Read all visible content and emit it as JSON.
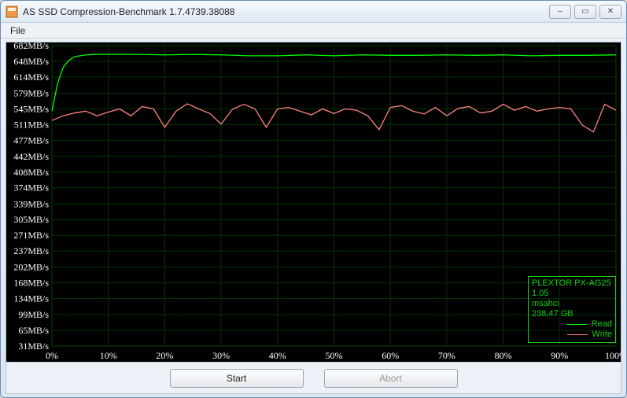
{
  "window": {
    "title": "AS SSD Compression-Benchmark 1.7.4739.38088",
    "minimize": "–",
    "maximize": "▭",
    "close": "✕"
  },
  "menu": {
    "file": "File"
  },
  "info": {
    "drive": "PLEXTOR PX-AG25",
    "fw": "1.05",
    "driver": "msahci",
    "size": "238,47 GB",
    "legend_read": "Read",
    "legend_write": "Write"
  },
  "buttons": {
    "start": "Start",
    "abort": "Abort"
  },
  "chart_data": {
    "type": "line",
    "title": "",
    "xlabel": "",
    "ylabel": "",
    "xlim": [
      0,
      100
    ],
    "ylim": [
      31,
      682
    ],
    "yticks": [
      682,
      648,
      614,
      579,
      545,
      511,
      477,
      442,
      408,
      374,
      339,
      305,
      271,
      237,
      202,
      168,
      134,
      99,
      65,
      31
    ],
    "ytick_suffix": "MB/s",
    "xticks": [
      0,
      10,
      20,
      30,
      40,
      50,
      60,
      70,
      80,
      90,
      100
    ],
    "xtick_suffix": "%",
    "series": [
      {
        "name": "Read",
        "color": "#00ff00",
        "x": [
          0,
          1,
          2,
          3,
          4,
          5,
          6,
          8,
          10,
          12,
          15,
          20,
          25,
          30,
          35,
          40,
          45,
          50,
          55,
          60,
          65,
          70,
          75,
          80,
          85,
          90,
          95,
          100
        ],
        "y": [
          540,
          600,
          635,
          650,
          658,
          660,
          662,
          663,
          663,
          663,
          663,
          662,
          663,
          662,
          660,
          660,
          662,
          660,
          662,
          661,
          661,
          662,
          661,
          662,
          660,
          661,
          661,
          662
        ]
      },
      {
        "name": "Write",
        "color": "#ff8080",
        "x": [
          0,
          2,
          4,
          6,
          8,
          10,
          12,
          14,
          16,
          18,
          20,
          22,
          24,
          26,
          28,
          30,
          32,
          34,
          36,
          38,
          40,
          42,
          44,
          46,
          48,
          50,
          52,
          54,
          56,
          58,
          60,
          62,
          64,
          66,
          68,
          70,
          72,
          74,
          76,
          78,
          80,
          82,
          84,
          86,
          88,
          90,
          92,
          94,
          96,
          98,
          100
        ],
        "y": [
          520,
          530,
          536,
          540,
          530,
          538,
          545,
          530,
          550,
          545,
          505,
          540,
          556,
          545,
          535,
          512,
          544,
          555,
          545,
          505,
          545,
          548,
          540,
          532,
          545,
          535,
          545,
          542,
          530,
          500,
          548,
          552,
          540,
          534,
          548,
          530,
          546,
          550,
          536,
          540,
          555,
          542,
          550,
          540,
          545,
          548,
          545,
          510,
          495,
          555,
          542
        ]
      }
    ]
  }
}
